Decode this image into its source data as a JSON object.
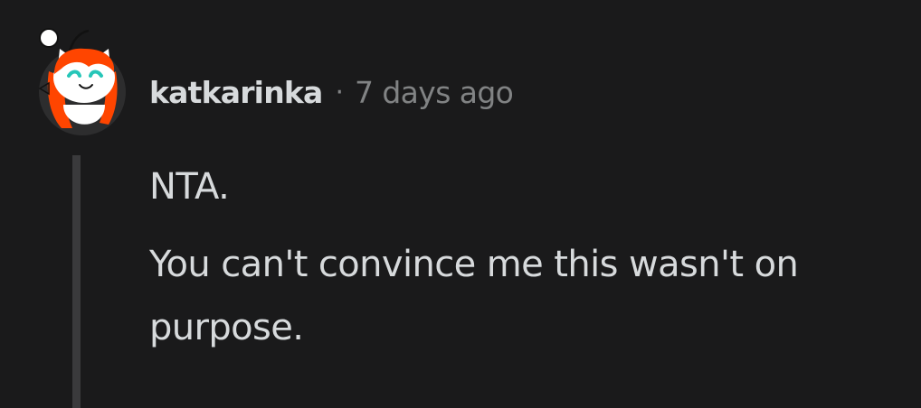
{
  "comment": {
    "author": "katkarinka",
    "separator": "·",
    "timestamp": "7 days ago",
    "avatar_icon": "snoo-avatar-icon",
    "paragraphs": [
      "NTA.",
      "You can't convince me this wasn't on purpose."
    ]
  },
  "colors": {
    "background": "#1a1a1b",
    "text_primary": "#d7dadc",
    "text_muted": "#818384",
    "thread_line": "#3a3a3c",
    "avatar_hair": "#ff4500"
  }
}
